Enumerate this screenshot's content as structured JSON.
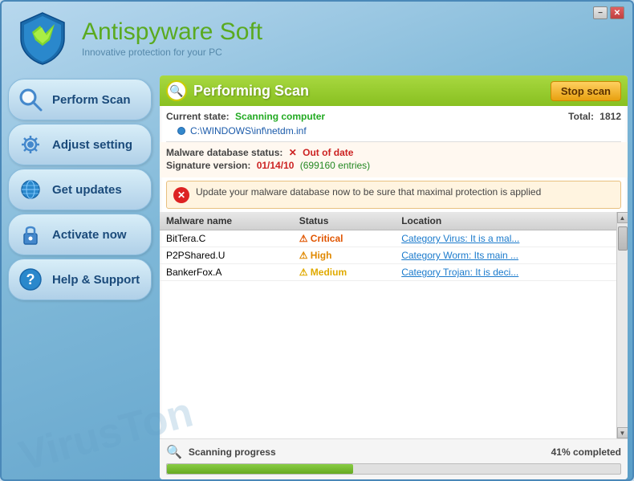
{
  "window": {
    "min_btn": "−",
    "close_btn": "✕"
  },
  "header": {
    "title_part1": "Antispyware",
    "title_part2": "Soft",
    "subtitle": "Innovative protection for your PC"
  },
  "sidebar": {
    "watermark": "VirusTon",
    "items": [
      {
        "id": "perform-scan",
        "label": "Perform Scan",
        "icon": "🔍"
      },
      {
        "id": "adjust-setting",
        "label": "Adjust setting",
        "icon": "⚙"
      },
      {
        "id": "get-updates",
        "label": "Get updates",
        "icon": "🌐"
      },
      {
        "id": "activate-now",
        "label": "Activate now",
        "icon": "🔒"
      },
      {
        "id": "help-support",
        "label": "Help & Support",
        "icon": "❓"
      }
    ]
  },
  "scan_header": {
    "title": "Performing Scan",
    "stop_btn": "Stop scan"
  },
  "status": {
    "label": "Current state:",
    "value": "Scanning computer",
    "total_label": "Total:",
    "total_value": "1812",
    "file_path": "C:\\WINDOWS\\inf\\netdm.inf"
  },
  "malware_db": {
    "status_label": "Malware database status:",
    "status_value": "Out of date",
    "sig_label": "Signature version:",
    "sig_value": "01/14/10",
    "entries": "(699160 entries)"
  },
  "warning": {
    "text": "Update your malware database now to be sure that maximal protection is applied"
  },
  "table": {
    "headers": [
      "Malware name",
      "Status",
      "Location"
    ],
    "rows": [
      {
        "name": "BitTera.C",
        "status": "Critical",
        "status_class": "critical",
        "location": "Category Virus: It is a mal..."
      },
      {
        "name": "P2PShared.U",
        "status": "High",
        "status_class": "high",
        "location": "Category Worm: Its main ..."
      },
      {
        "name": "BankerFox.A",
        "status": "Medium",
        "status_class": "medium",
        "location": "Category Trojan: It is deci..."
      }
    ]
  },
  "progress": {
    "label": "Scanning progress",
    "percent": "41% completed",
    "fill_width": "41%"
  }
}
